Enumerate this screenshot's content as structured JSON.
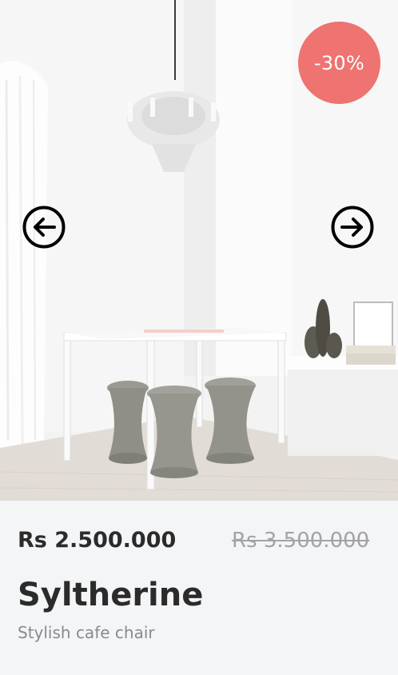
{
  "carousel": {
    "discount_badge": "-30%",
    "prev_icon": "arrow-left-circle-icon",
    "next_icon": "arrow-right-circle-icon"
  },
  "product": {
    "price": "Rs 2.500.000",
    "old_price": "Rs 3.500.000",
    "name": "Syltherine",
    "description": "Stylish cafe chair"
  },
  "colors": {
    "badge": "#ee7371",
    "text_dark": "#2b2b2b",
    "text_muted": "#8a8a8a",
    "text_strikethrough": "#a3a3a3",
    "panel_bg": "#f4f5f7"
  }
}
